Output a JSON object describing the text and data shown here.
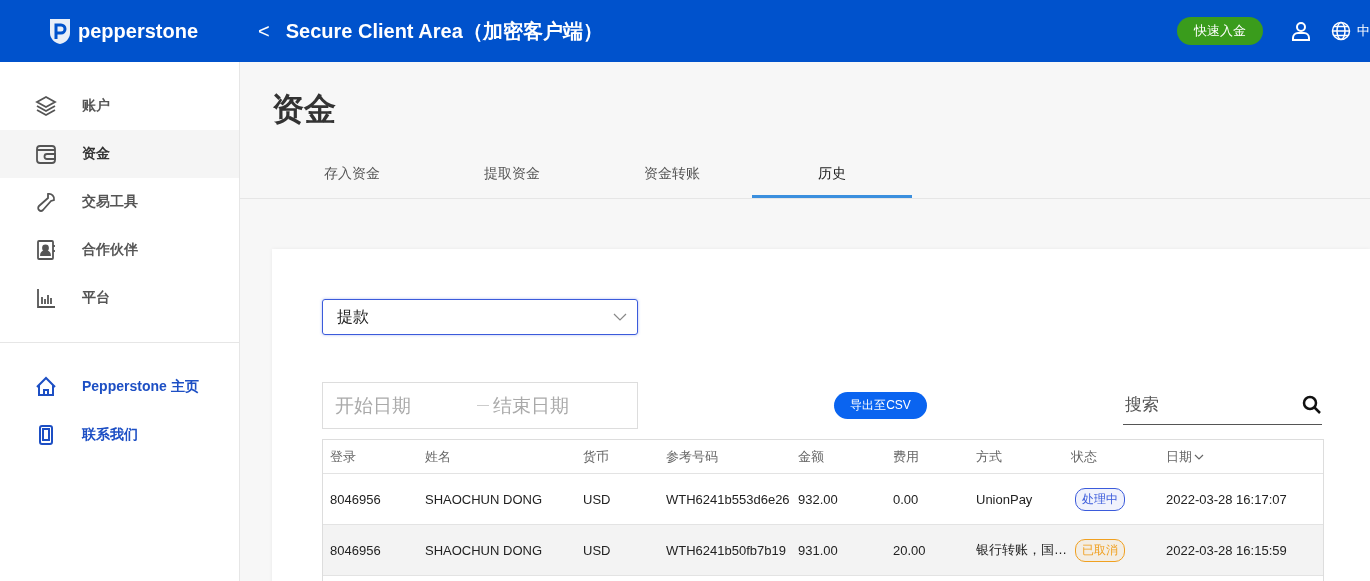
{
  "header": {
    "logo": "pepperstone",
    "back": "<",
    "title": "Secure Client Area（加密客户端）",
    "deposit_button": "快速入金",
    "language": "中"
  },
  "sidebar": {
    "items": [
      {
        "kind": "layers",
        "label": "账户",
        "selected": false
      },
      {
        "kind": "wallet",
        "label": "资金",
        "selected": true
      },
      {
        "kind": "wrench",
        "label": "交易工具",
        "selected": false
      },
      {
        "kind": "contact",
        "label": "合作伙伴",
        "selected": false
      },
      {
        "kind": "chart",
        "label": "平台",
        "selected": false
      }
    ],
    "links": [
      {
        "kind": "home",
        "label": "Pepperstone 主页"
      },
      {
        "kind": "phone",
        "label": "联系我们"
      }
    ]
  },
  "page_title": "资金",
  "tabs": [
    {
      "label": "存入资金",
      "selected": false
    },
    {
      "label": "提取资金",
      "selected": false
    },
    {
      "label": "资金转账",
      "selected": false
    },
    {
      "label": "历史",
      "selected": true
    }
  ],
  "type_select": {
    "value": "提款"
  },
  "date_range": {
    "start_placeholder": "开始日期",
    "end_placeholder": "结束日期"
  },
  "export_button": "导出至CSV",
  "search": {
    "placeholder": "搜索"
  },
  "table": {
    "columns": [
      {
        "label": "登录",
        "sorted": false
      },
      {
        "label": "姓名",
        "sorted": false
      },
      {
        "label": "货币",
        "sorted": false
      },
      {
        "label": "参考号码",
        "sorted": false
      },
      {
        "label": "金额",
        "sorted": false
      },
      {
        "label": "费用",
        "sorted": false
      },
      {
        "label": "方式",
        "sorted": false
      },
      {
        "label": "状态",
        "sorted": false
      },
      {
        "label": "日期",
        "sorted": true
      }
    ],
    "rows": [
      {
        "cells": [
          "8046956",
          "SHAOCHUN DONG",
          "USD",
          "WTH6241b553d6e26",
          "932.00",
          "0.00",
          "UnionPay"
        ],
        "status": {
          "label": "处理中",
          "color": "#3b5bdb"
        },
        "date": "2022-03-28 16:17:07",
        "selected": false
      },
      {
        "cells": [
          "8046956",
          "SHAOCHUN DONG",
          "USD",
          "WTH6241b50fb7b19",
          "931.00",
          "20.00",
          "银行转账，国…"
        ],
        "status": {
          "label": "已取消",
          "color": "#f0a020"
        },
        "date": "2022-03-28 16:15:59",
        "selected": true
      }
    ]
  }
}
